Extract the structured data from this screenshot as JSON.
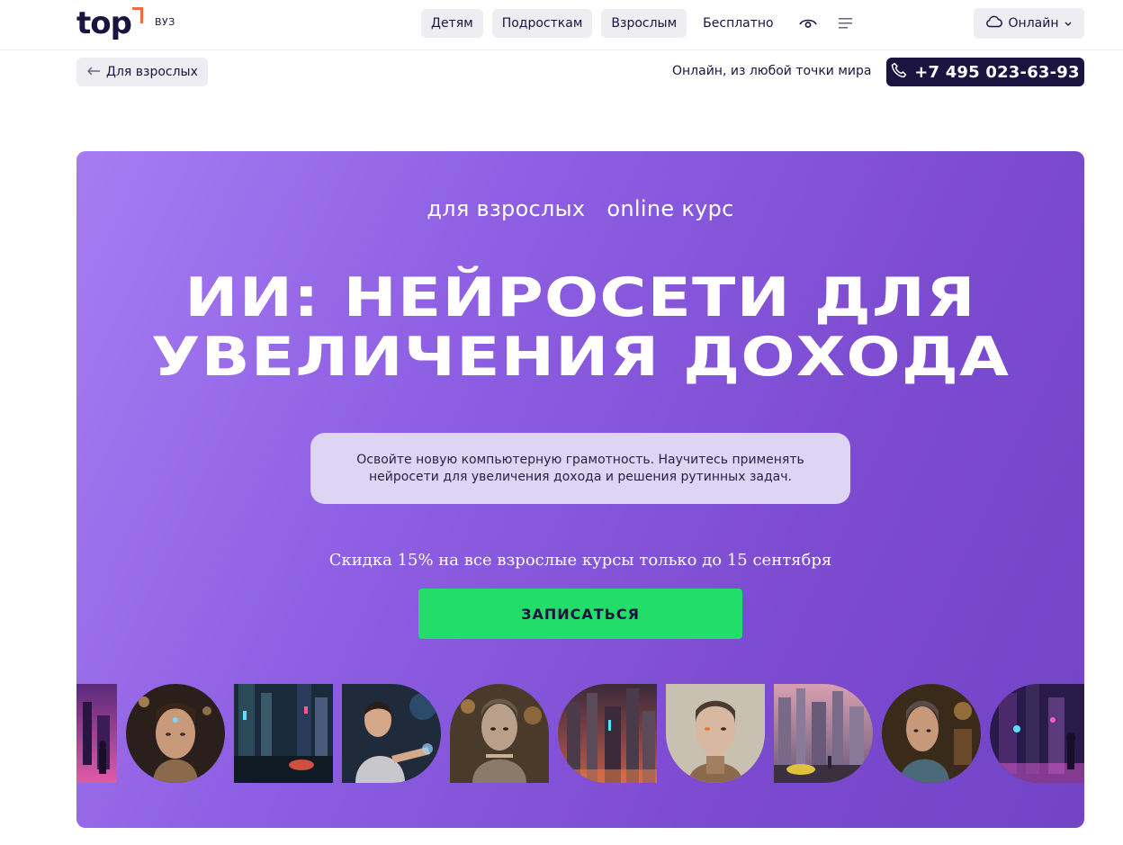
{
  "header": {
    "logo_text": "top",
    "logo_sub": "ВУЗ",
    "nav": [
      "Детям",
      "Подросткам",
      "Взрослым"
    ],
    "nav_free": "Бесплатно",
    "accessibility_icon": "eye-icon",
    "menu_icon": "menu-icon",
    "online_label": "Онлайн"
  },
  "subheader": {
    "back_label": "Для взрослых",
    "location": "Онлайн, из любой точки мира",
    "phone": "+7 495 023-63-93"
  },
  "hero": {
    "tag_audience": "для взрослых",
    "tag_format": "online курс",
    "title_line1": "ИИ: НЕЙРОСЕТИ ДЛЯ",
    "title_line2": "УВЕЛИЧЕНИЯ ДОХОДА",
    "description": "Освойте новую компьютерную грамотность. Научитесь применять нейросети для увеличения дохода и решения рутинных задач.",
    "discount": "Скидка 15% на все взрослые курсы только до 15 сентября",
    "cta_label": "ЗАПИСАТЬСЯ"
  },
  "colors": {
    "brand_dark": "#1b1440",
    "accent_orange": "#f26b3a",
    "hero_purple": "#8e5fe3",
    "cta_green": "#22dd6a"
  },
  "gallery": [
    {
      "name": "city-figure-image",
      "shape": "r-none"
    },
    {
      "name": "cyborg-woman-image",
      "shape": "r-full"
    },
    {
      "name": "neon-street-image",
      "shape": "r-none"
    },
    {
      "name": "man-hologram-image",
      "shape": "r-right"
    },
    {
      "name": "robot-woman-image",
      "shape": "r-top"
    },
    {
      "name": "city-skyline-image",
      "shape": "r-left"
    },
    {
      "name": "android-face-image",
      "shape": "r-bottom"
    },
    {
      "name": "city-car-image",
      "shape": "r-right"
    },
    {
      "name": "cyborg-portrait-image",
      "shape": "r-full"
    },
    {
      "name": "neon-alley-image",
      "shape": "r-left"
    }
  ]
}
